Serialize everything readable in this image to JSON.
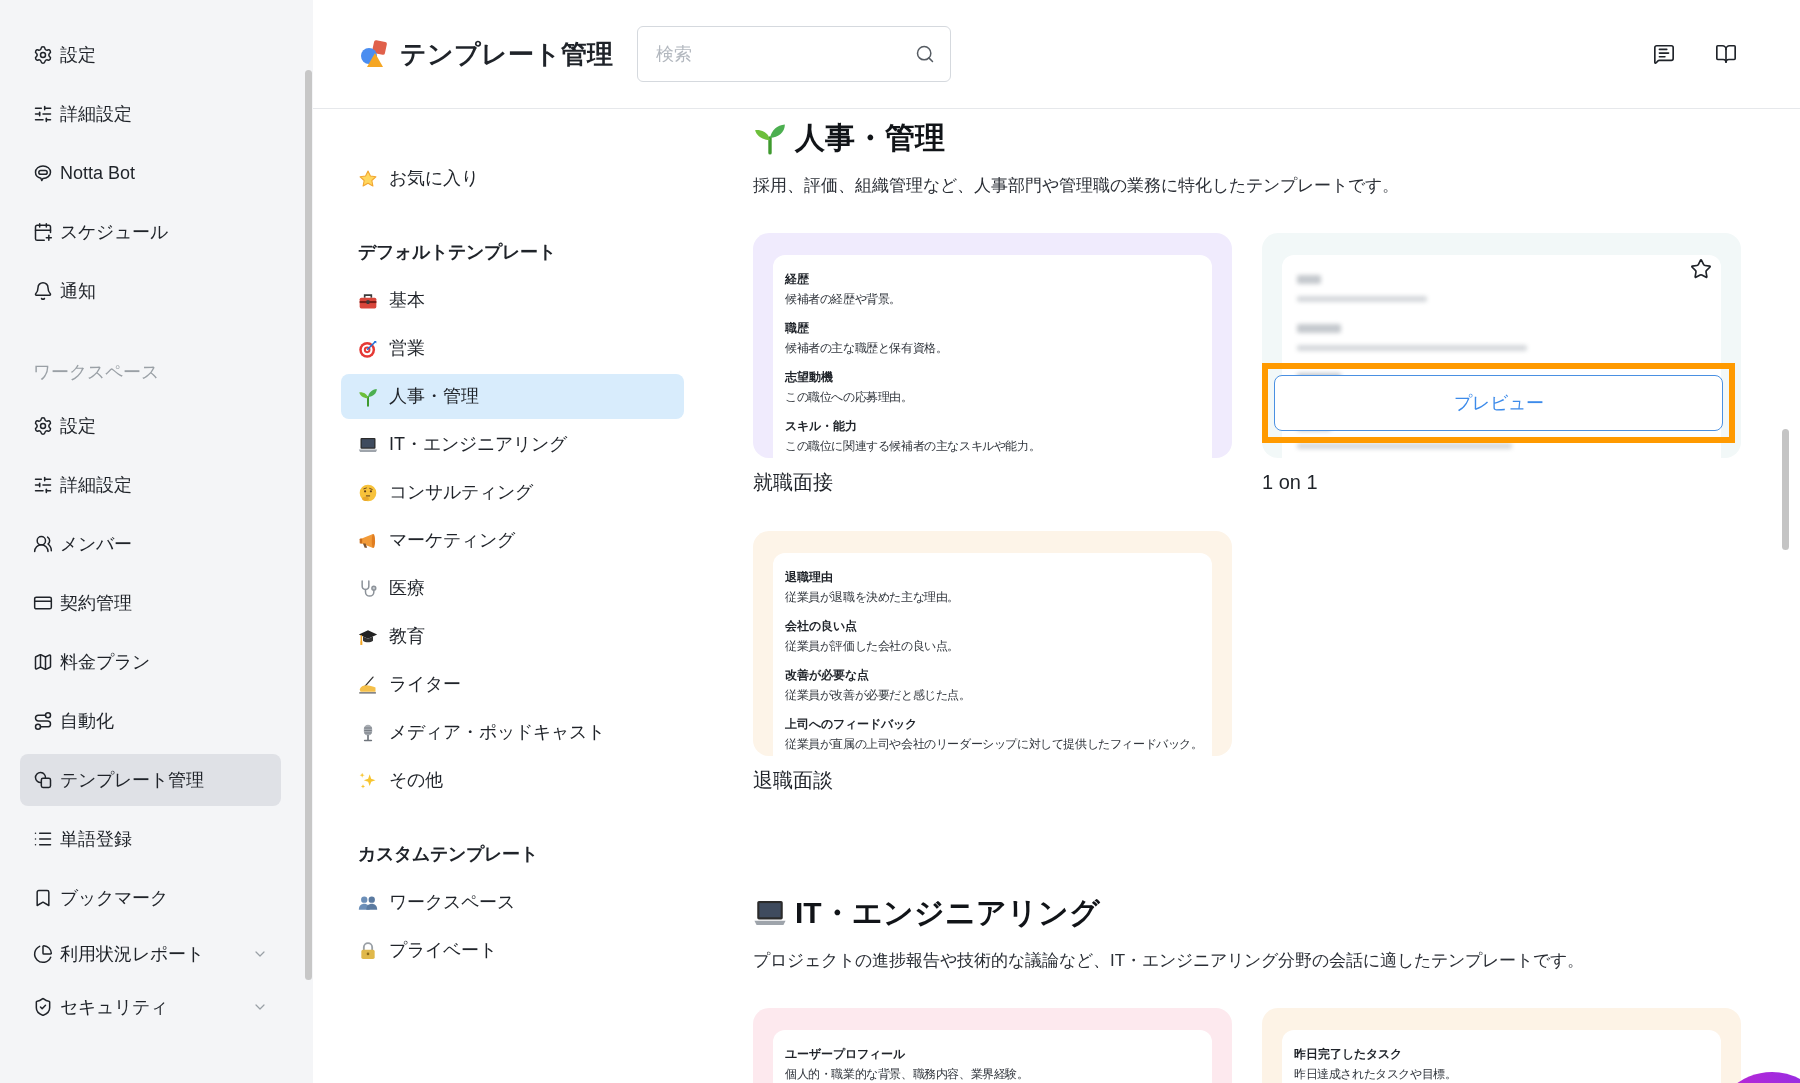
{
  "sidebar": {
    "sections": [
      {
        "items": [
          {
            "label": "設定",
            "kind": "link",
            "selected": false
          },
          {
            "label": "詳細設定",
            "kind": "link",
            "selected": false
          },
          {
            "label": "Notta Bot",
            "kind": "link",
            "selected": false
          },
          {
            "label": "スケジュール",
            "kind": "link",
            "selected": false
          },
          {
            "label": "通知",
            "kind": "link",
            "selected": false
          }
        ]
      },
      {
        "title": "ワークスペース",
        "items": [
          {
            "label": "設定",
            "kind": "link",
            "selected": false
          },
          {
            "label": "詳細設定",
            "kind": "link",
            "selected": false
          },
          {
            "label": "メンバー",
            "kind": "link",
            "selected": false
          },
          {
            "label": "契約管理",
            "kind": "link",
            "selected": false
          },
          {
            "label": "料金プラン",
            "kind": "link",
            "selected": false
          },
          {
            "label": "自動化",
            "kind": "link",
            "selected": false
          },
          {
            "label": "テンプレート管理",
            "kind": "link",
            "selected": true
          },
          {
            "label": "単語登録",
            "kind": "link",
            "selected": false
          },
          {
            "label": "ブックマーク",
            "kind": "link",
            "selected": false
          },
          {
            "label": "利用状況レポート",
            "kind": "group",
            "selected": false,
            "expanded": false
          },
          {
            "label": "セキュリティ",
            "kind": "group",
            "selected": false,
            "expanded": false
          }
        ]
      }
    ]
  },
  "header": {
    "title": "テンプレート管理",
    "search": {
      "placeholder": "検索"
    }
  },
  "template_nav": {
    "favorites": {
      "label": "お気に入り",
      "selected": false
    },
    "groups": [
      {
        "title": "デフォルトテンプレート",
        "items": [
          {
            "label": "基本",
            "selected": false
          },
          {
            "label": "営業",
            "selected": false
          },
          {
            "label": "人事・管理",
            "selected": true
          },
          {
            "label": "IT・エンジニアリング",
            "selected": false
          },
          {
            "label": "コンサルティング",
            "selected": false
          },
          {
            "label": "マーケティング",
            "selected": false
          },
          {
            "label": "医療",
            "selected": false
          },
          {
            "label": "教育",
            "selected": false
          },
          {
            "label": "ライター",
            "selected": false
          },
          {
            "label": "メディア・ポッドキャスト",
            "selected": false
          },
          {
            "label": "その他",
            "selected": false
          }
        ]
      },
      {
        "title": "カスタムテンプレート",
        "items": [
          {
            "label": "ワークスペース",
            "selected": false
          },
          {
            "label": "プライベート",
            "selected": false
          }
        ]
      }
    ]
  },
  "sections": [
    {
      "title": "人事・管理",
      "description": "採用、評価、組織管理など、人事部門や管理職の業務に特化したテンプレートです。",
      "templates": [
        {
          "name": "就職面接",
          "color": "#f0ebfd",
          "hovered": false,
          "favorite": false,
          "highlighted": false,
          "fields": [
            {
              "heading": "経歴",
              "text": "候補者の経歴や背景。"
            },
            {
              "heading": "職歴",
              "text": "候補者の主な職歴と保有資格。"
            },
            {
              "heading": "志望動機",
              "text": "この職位への応募理由。"
            },
            {
              "heading": "スキル・能力",
              "text": "この職位に関連する候補者の主なスキルや能力。"
            }
          ]
        },
        {
          "name": "1 on 1",
          "color": "#f2f8f8",
          "hovered": true,
          "favorite": false,
          "highlighted": true,
          "preview_label": "プレビュー"
        },
        {
          "name": "退職面談",
          "color": "#fdf4e8",
          "hovered": false,
          "favorite": false,
          "highlighted": false,
          "fields": [
            {
              "heading": "退職理由",
              "text": "従業員が退職を決めた主な理由。"
            },
            {
              "heading": "会社の良い点",
              "text": "従業員が評価した会社の良い点。"
            },
            {
              "heading": "改善が必要な点",
              "text": "従業員が改善が必要だと感じた点。"
            },
            {
              "heading": "上司へのフィードバック",
              "text": "従業員が直属の上司や会社のリーダーシップに対して提供したフィードバック。"
            }
          ]
        }
      ]
    },
    {
      "title": "IT・エンジニアリング",
      "description": "プロジェクトの進捗報告や技術的な議論など、IT・エンジニアリング分野の会話に適したテンプレートです。",
      "templates": [
        {
          "color": "#fde9ee",
          "hovered": false,
          "favorite": false,
          "highlighted": false,
          "fields": [
            {
              "heading": "ユーザープロフィール",
              "text": "個人的・職業的な背景、職務内容、業界経験。"
            }
          ]
        },
        {
          "color": "#fdf3e6",
          "hovered": false,
          "favorite": false,
          "highlighted": false,
          "fields": [
            {
              "heading": "昨日完了したタスク",
              "text": "昨日達成されたタスクや目標。"
            }
          ]
        }
      ]
    }
  ]
}
